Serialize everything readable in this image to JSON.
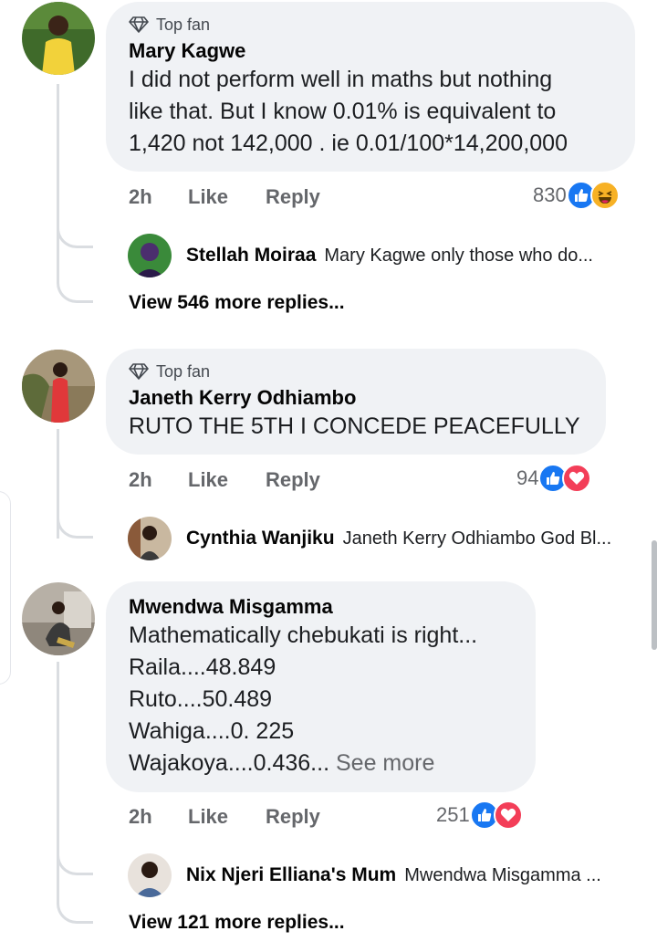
{
  "comments": [
    {
      "top_fan_label": "Top fan",
      "author": "Mary Kagwe",
      "text": "I did not perform well in maths but nothing\nlike that. But I know 0.01% is equivalent to\n1,420 not 142,000 . ie 0.01/100*14,200,000",
      "time": "2h",
      "like_label": "Like",
      "reply_label": "Reply",
      "reaction_count": "830",
      "reactions": [
        "like-reaction-icon",
        "haha-reaction-icon"
      ],
      "reply": {
        "author": "Stellah Moiraa",
        "text": "Mary Kagwe only those who do..."
      },
      "more_replies": "View 546 more replies..."
    },
    {
      "top_fan_label": "Top fan",
      "author": "Janeth Kerry Odhiambo",
      "text": "RUTO THE 5TH I CONCEDE PEACEFULLY",
      "time": "2h",
      "like_label": "Like",
      "reply_label": "Reply",
      "reaction_count": "94",
      "reactions": [
        "like-reaction-icon",
        "love-reaction-icon"
      ],
      "reply": {
        "author": "Cynthia Wanjiku",
        "text": "Janeth Kerry Odhiambo God Bl..."
      }
    },
    {
      "author": "Mwendwa Misgamma",
      "text": "Mathematically chebukati is right...\nRaila....48.849\nRuto....50.489\nWahiga....0. 225\nWajakoya....0.436...",
      "see_more": "See more",
      "time": "2h",
      "like_label": "Like",
      "reply_label": "Reply",
      "reaction_count": "251",
      "reactions": [
        "like-reaction-icon",
        "love-reaction-icon"
      ],
      "reply": {
        "author": "Nix Njeri Elliana's Mum",
        "text": "Mwendwa Misgamma ..."
      },
      "more_replies": "View 121 more replies..."
    }
  ],
  "colors": {
    "bubble": "#f0f2f5",
    "muted_text": "#65676b",
    "like_blue": "#1877f2",
    "love_red": "#f33e58",
    "haha_yellow": "#f7b125"
  }
}
